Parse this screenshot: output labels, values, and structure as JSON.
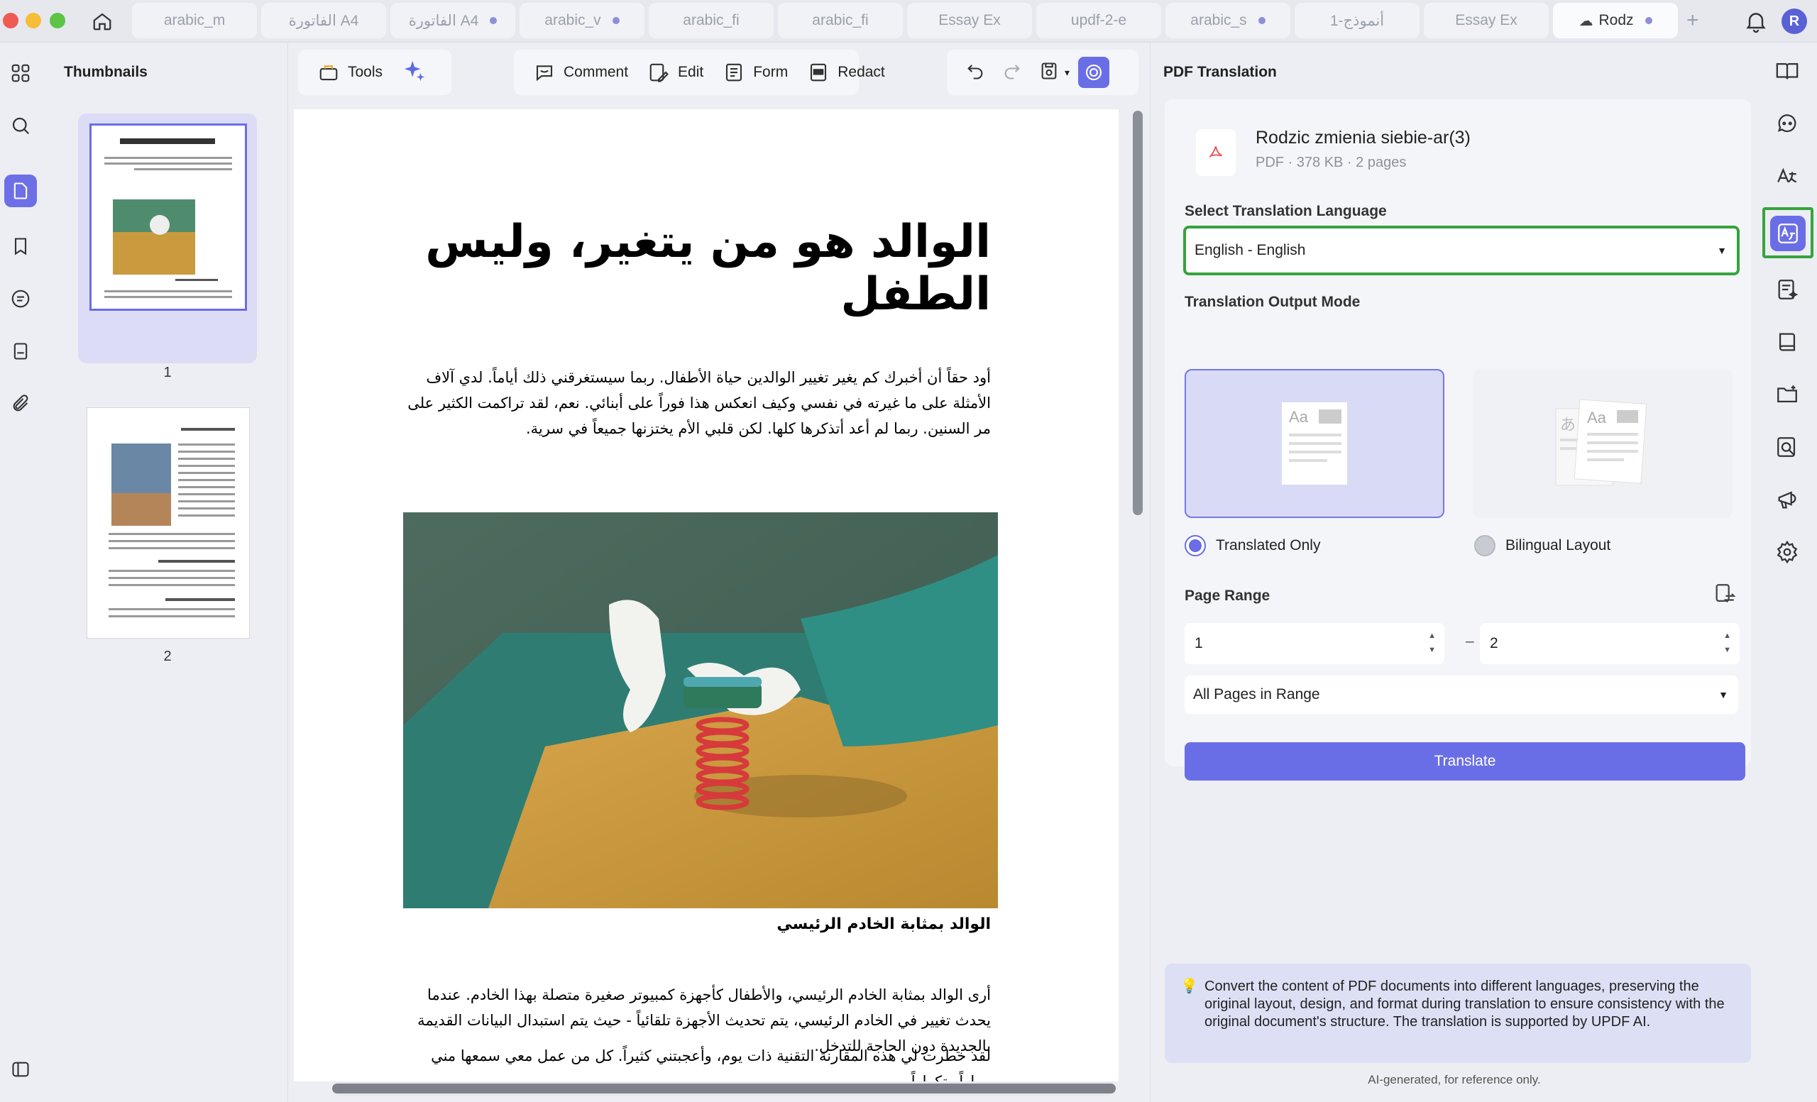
{
  "tabs": [
    {
      "label": "arabic_m",
      "dot": false
    },
    {
      "label": "الفاتورة A4",
      "dot": false
    },
    {
      "label": "الفاتورة A4",
      "dot": true
    },
    {
      "label": "arabic_v",
      "dot": true
    },
    {
      "label": "arabic_fi",
      "dot": false
    },
    {
      "label": "arabic_fi",
      "dot": false
    },
    {
      "label": "Essay Ex",
      "dot": false
    },
    {
      "label": "updf-2-e",
      "dot": false
    },
    {
      "label": "arabic_s",
      "dot": true
    },
    {
      "label": "أنموذج-1",
      "dot": false
    },
    {
      "label": "Essay Ex",
      "dot": false
    },
    {
      "label": "Rodz",
      "dot": true,
      "active": true
    }
  ],
  "user": {
    "avatar_initial": "R"
  },
  "thumbnails": {
    "title": "Thumbnails",
    "pages": [
      "1",
      "2"
    ]
  },
  "toolbar": {
    "tools": "Tools",
    "comment": "Comment",
    "edit": "Edit",
    "form": "Form",
    "redact": "Redact"
  },
  "document": {
    "title": "الوالد هو من يتغير، وليس الطفل",
    "para1": "أود حقاً أن أخبرك كم يغير تغيير الوالدين حياة الأطفال. ربما سيستغرقني ذلك أياماً. لدي آلاف الأمثلة على ما غيرته في نفسي وكيف انعكس هذا فوراً على أبنائي. نعم، لقد تراكمت الكثير على مر السنين. ربما لم أعد أتذكرها كلها. لكن قلبي الأم يختزنها جميعاً في سرية.",
    "subheading": "الوالد بمثابة الخادم الرئيسي",
    "para2": "أرى الوالد بمثابة الخادم الرئيسي، والأطفال كأجهزة كمبيوتر صغيرة متصلة بهذا الخادم. عندما يحدث تغيير في الخادم الرئيسي، يتم تحديث الأجهزة تلقائياً - حيث يتم استبدال البيانات القديمة بالجديدة دون الحاجة للتدخل.",
    "para3": "لقد خطرت لي هذه المقارنة التقنية ذات يوم، وأعجبتني كثيراً. كل من عمل معي سمعها مني مراراً وتكراراً."
  },
  "panel": {
    "title": "PDF Translation",
    "file_name": "Rodzic zmienia siebie-ar(3)",
    "file_meta": "PDF · 378 KB · 2 pages",
    "language_label": "Select Translation Language",
    "language_value": "English - English",
    "output_mode_label": "Translation Output Mode",
    "mode_translated": "Translated Only",
    "mode_bilingual": "Bilingual Layout",
    "page_range_label": "Page Range",
    "range_from": "1",
    "range_to": "2",
    "range_option": "All Pages in Range",
    "translate_button": "Translate",
    "info_text": "Convert the content of PDF documents into different languages, preserving the original layout, design, and format during translation to ensure consistency with the original document's structure. The translation is supported by UPDF AI.",
    "ai_note": "AI-generated, for reference only."
  },
  "colors": {
    "accent": "#6a6ee6",
    "highlight": "#36a33d"
  }
}
